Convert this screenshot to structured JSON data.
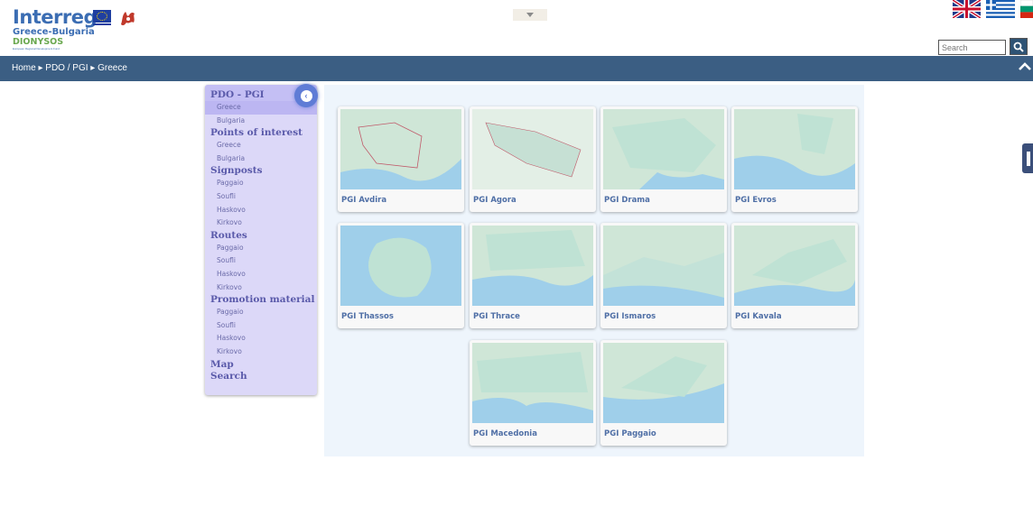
{
  "header": {
    "logo_title": "Interreg",
    "logo_subtitle": "Greece-Bulgaria",
    "logo_project": "DIONYSOS",
    "logo_tagline": "European Regional Development Fund",
    "search_placeholder": "Search",
    "languages": [
      "English",
      "Greek",
      "Bulgarian"
    ]
  },
  "breadcrumb": {
    "home": "Home",
    "section": "PDO / PGI",
    "current": "Greece",
    "separator": "▸"
  },
  "sidebar": {
    "groups": [
      {
        "title": "PDO - PGI",
        "items": [
          "Greece",
          "Bulgaria"
        ],
        "selected": "Greece"
      },
      {
        "title": "Points of interest",
        "items": [
          "Greece",
          "Bulgaria"
        ]
      },
      {
        "title": "Signposts",
        "items": [
          "Paggaio",
          "Soufli",
          "Haskovo",
          "Kirkovo"
        ]
      },
      {
        "title": "Routes",
        "items": [
          "Paggaio",
          "Soufli",
          "Haskovo",
          "Kirkovo"
        ]
      },
      {
        "title": "Promotion material",
        "items": [
          "Paggaio",
          "Soufli",
          "Haskovo",
          "Kirkovo"
        ]
      },
      {
        "title": "Map",
        "items": []
      },
      {
        "title": "Search",
        "items": []
      }
    ]
  },
  "cards": [
    {
      "label": "PGI Avdira"
    },
    {
      "label": "PGI Agora"
    },
    {
      "label": "PGI Drama"
    },
    {
      "label": "PGI Evros"
    },
    {
      "label": "PGI Thassos"
    },
    {
      "label": "PGI Thrace"
    },
    {
      "label": "PGI Ismaros"
    },
    {
      "label": "PGI Kavala"
    },
    {
      "label": "PGI Macedonia"
    },
    {
      "label": "PGI Paggaio"
    }
  ],
  "colors": {
    "navbar": "#3b5e83",
    "sidebar_bg": "#dcd8f8",
    "sidebar_text": "#5a5aaa",
    "card_label": "#4f6fa6",
    "map_land": "#cfe6d7",
    "map_sea": "#9fcfea"
  }
}
